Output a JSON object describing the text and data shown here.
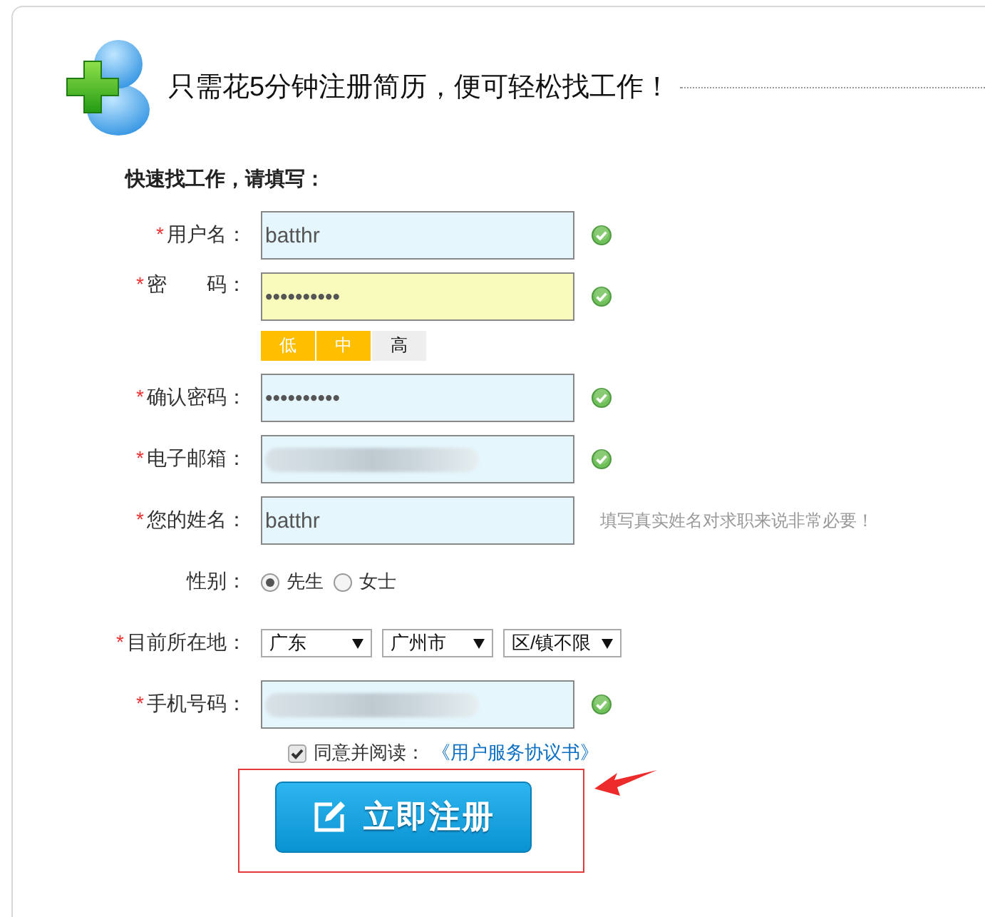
{
  "header": {
    "title": "只需花5分钟注册简历，便可轻松找工作！",
    "subtitle": "快速找工作，请填写："
  },
  "fields": [
    {
      "kind": "text",
      "asterisk": "*",
      "label": "用户名：",
      "value": "batthr",
      "valid": true,
      "highlighted": false
    },
    {
      "kind": "password",
      "asterisk": "*",
      "label": "密　　码：",
      "value": "••••••••••",
      "valid": true,
      "highlighted": true,
      "strength": [
        {
          "label": "低",
          "on": true
        },
        {
          "label": "中",
          "on": true
        },
        {
          "label": "高",
          "on": false
        }
      ]
    },
    {
      "kind": "password",
      "asterisk": "*",
      "label": "确认密码：",
      "value": "••••••••••",
      "valid": true,
      "highlighted": false
    },
    {
      "kind": "text",
      "asterisk": "*",
      "label": "电子邮箱：",
      "redacted": true,
      "valid": true,
      "highlighted": false
    },
    {
      "kind": "text",
      "asterisk": "*",
      "label": "您的姓名：",
      "value": "batthr",
      "valid": false,
      "highlighted": false,
      "hint": "填写真实姓名对求职来说非常必要！"
    },
    {
      "kind": "radio",
      "label": "性别：",
      "options": [
        {
          "label": "先生",
          "selected": true
        },
        {
          "label": "女士",
          "selected": false
        }
      ]
    },
    {
      "kind": "select",
      "asterisk": "*",
      "label": "目前所在地：",
      "selects": [
        "广东",
        "广州市",
        "区/镇不限"
      ]
    },
    {
      "kind": "text",
      "asterisk": "*",
      "label": "手机号码：",
      "redacted": true,
      "valid": true,
      "highlighted": false
    }
  ],
  "agreement": {
    "checked": true,
    "text": "同意并阅读：",
    "link": "《用户服务协议书》"
  },
  "submit": {
    "label": "立即注册",
    "annotated": true
  }
}
